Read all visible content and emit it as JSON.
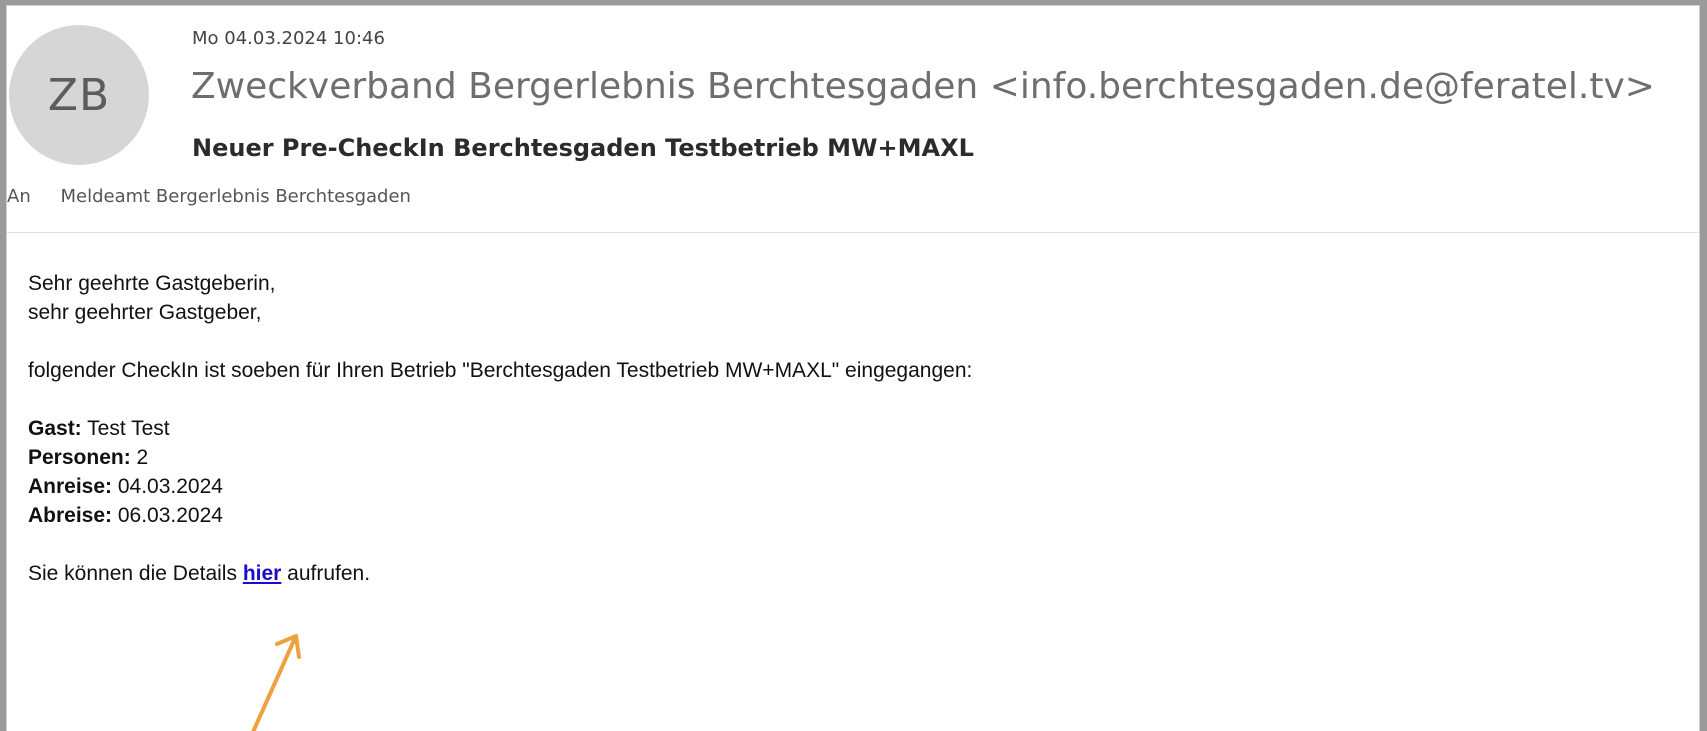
{
  "email": {
    "avatar_initials": "ZB",
    "date": "Mo 04.03.2024 10:46",
    "from": "Zweckverband Bergerlebnis Berchtesgaden <info.berchtesgaden.de@feratel.tv>",
    "subject": "Neuer Pre-CheckIn Berchtesgaden Testbetrieb MW+MAXL",
    "to_label": "An",
    "to_value": "Meldeamt Bergerlebnis Berchtesgaden"
  },
  "body": {
    "greeting_line1": "Sehr geehrte Gastgeberin,",
    "greeting_line2": "sehr geehrter Gastgeber,",
    "intro": "folgender CheckIn ist soeben für Ihren Betrieb \"Berchtesgaden Testbetrieb MW+MAXL\" eingegangen:",
    "guest_label": "Gast:",
    "guest_value": " Test Test",
    "persons_label": "Personen:",
    "persons_value": " 2",
    "arrival_label": "Anreise:",
    "arrival_value": " 04.03.2024",
    "departure_label": "Abreise:",
    "departure_value": " 06.03.2024",
    "details_prefix": "Sie können die Details ",
    "details_link": "hier",
    "details_suffix": " aufrufen."
  },
  "annotation": {
    "arrow_color": "#f0a040",
    "arrow_icon": "arrow-up-right-icon"
  },
  "colors": {
    "link": "#1a0dcc",
    "avatar_bg": "#d6d6d6"
  }
}
